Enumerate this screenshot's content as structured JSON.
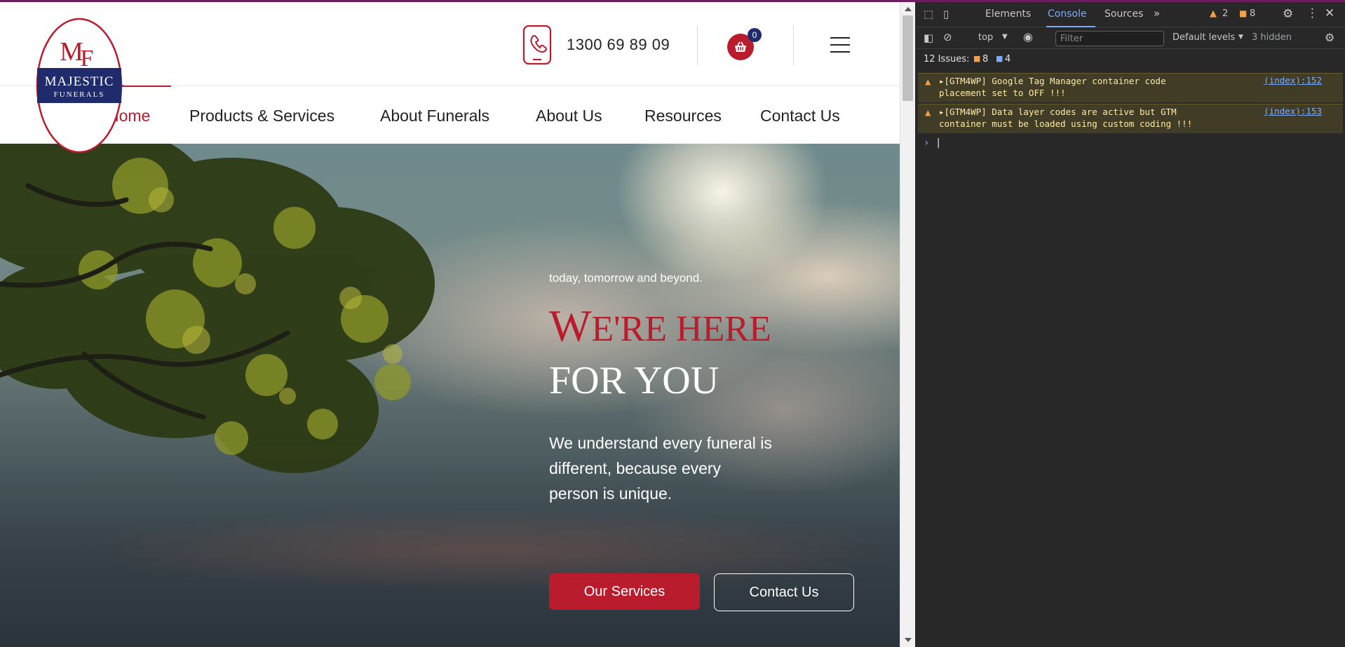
{
  "site": {
    "logo": {
      "monogram": "MF",
      "name": "MAJESTIC",
      "sub": "FUNERALS"
    },
    "phone": "1300 69 89 09",
    "cart_count": "0",
    "nav": [
      {
        "label": "Home",
        "active": true
      },
      {
        "label": "Products & Services",
        "active": false
      },
      {
        "label": "About Funerals",
        "active": false
      },
      {
        "label": "About Us",
        "active": false
      },
      {
        "label": "Resources",
        "active": false
      },
      {
        "label": "Contact Us",
        "active": false
      }
    ],
    "hero": {
      "subtitle": "today, tomorrow and beyond.",
      "title_line1_cap": "W",
      "title_line1_rest": "E'RE HERE",
      "title_line2": "FOR YOU",
      "body": "We understand every funeral is different, because every person is unique.",
      "primary_button": "Our Services",
      "secondary_button": "Contact Us"
    },
    "colors": {
      "brand_red": "#b81c2d",
      "brand_navy": "#1f2b6a"
    }
  },
  "devtools": {
    "tabs": [
      "Elements",
      "Console",
      "Sources"
    ],
    "active_tab": "Console",
    "warning_count": "2",
    "issue_count_badge": "8",
    "context": "top",
    "filter_placeholder": "Filter",
    "levels": "Default levels",
    "hidden": "3 hidden",
    "issues_label": "12 Issues:",
    "issues_errors": "8",
    "issues_info": "4",
    "messages": [
      {
        "text": "[GTM4WP] Google Tag Manager container code placement set to OFF !!!",
        "source": "(index):152"
      },
      {
        "text": "[GTM4WP] Data layer codes are active but GTM container must be loaded using custom coding !!!",
        "source": "(index):153"
      }
    ]
  }
}
